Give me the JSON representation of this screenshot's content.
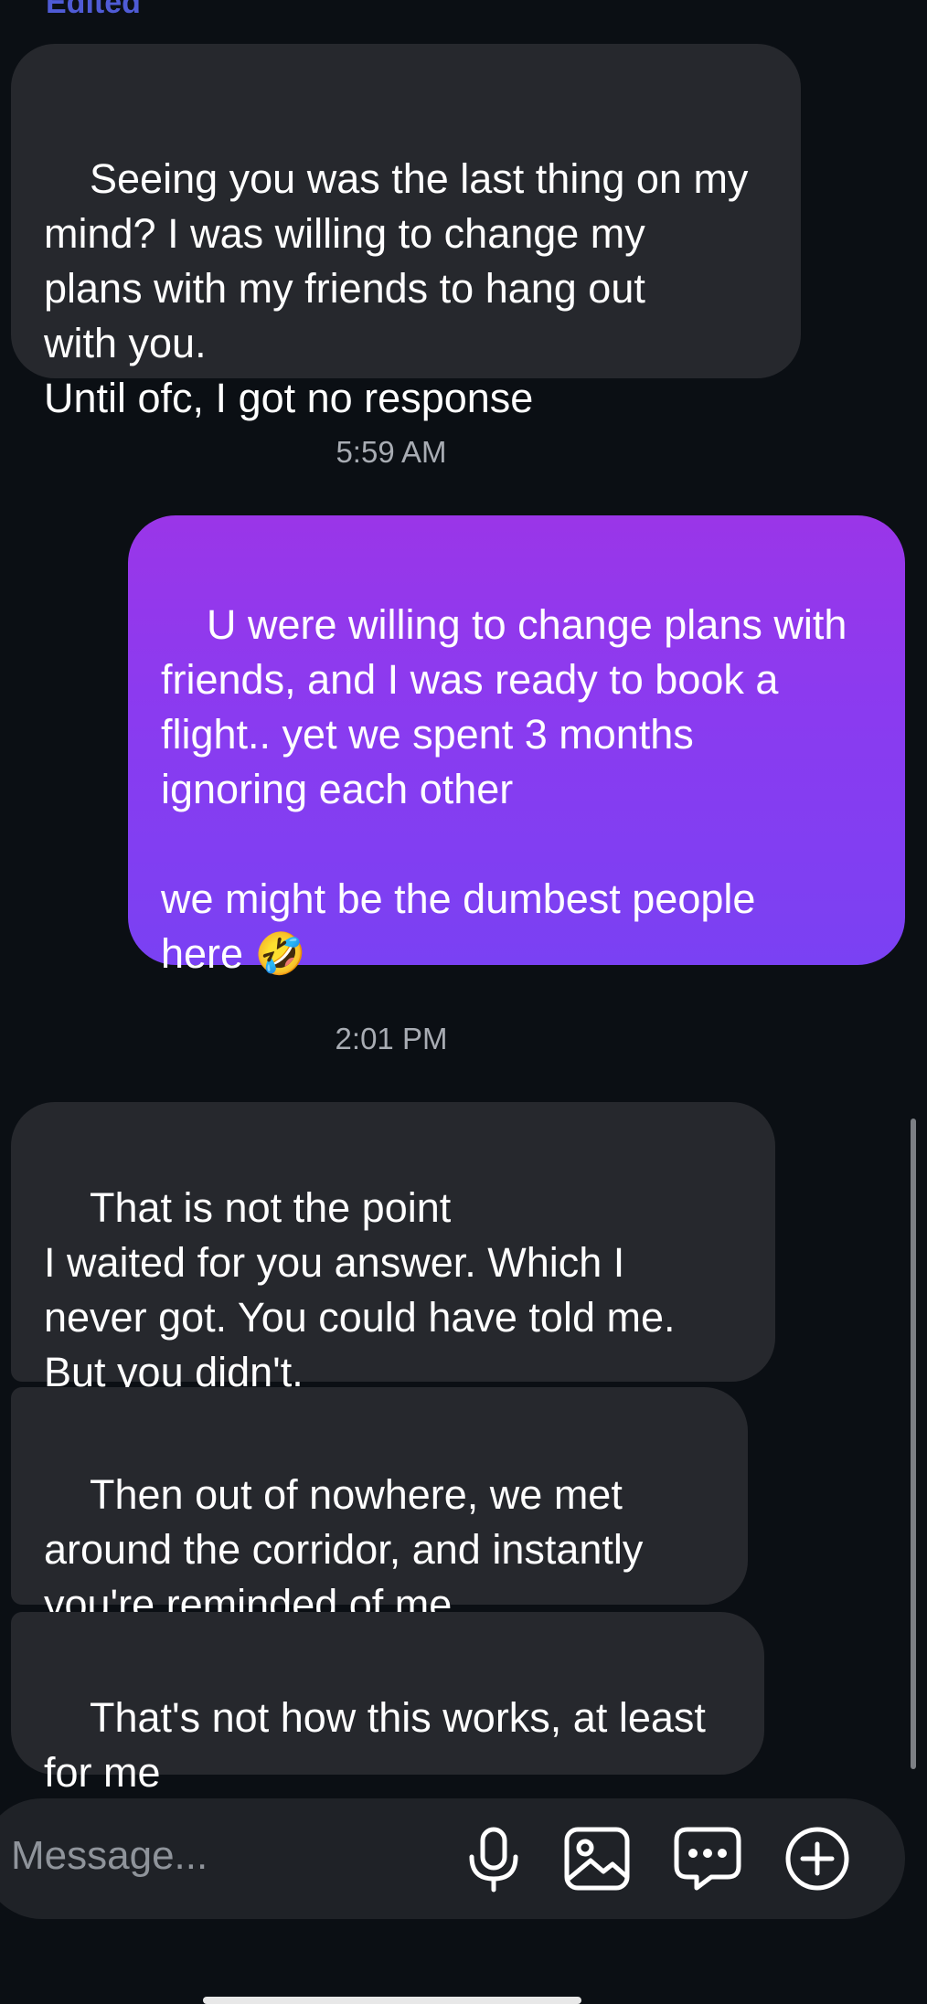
{
  "thread": {
    "edited_label": "Edited",
    "messages": [
      {
        "side": "received",
        "text": "Seeing you was the last thing on my\nmind? I was willing to change my\nplans with my friends to hang out\nwith you.\nUntil ofc, I got no response"
      },
      {
        "timestamp": "5:59 AM"
      },
      {
        "side": "sent",
        "text": "U were willing to change plans with\nfriends, and I was ready to book a\nflight.. yet we spent 3 months\nignoring each other\n\nwe might be the dumbest people\nhere 🤣"
      },
      {
        "timestamp": "2:01 PM"
      },
      {
        "side": "received",
        "text": "That is not the point\nI waited for you answer. Which I\nnever got. You could have told me.\nBut you didn't."
      },
      {
        "side": "received",
        "text": "Then out of nowhere, we met\naround the corridor, and instantly\nyou're reminded of me"
      },
      {
        "side": "received",
        "text": "That's not how this works, at least\nfor me"
      }
    ]
  },
  "composer": {
    "placeholder": "Message...",
    "icons": [
      "microphone-icon",
      "image-icon",
      "sticker-chat-icon",
      "plus-icon"
    ]
  },
  "colors": {
    "background": "#0b0f14",
    "received_bubble": "#26282d",
    "sent_bubble_top": "#9a36e8",
    "sent_bubble_bottom": "#7a41f3",
    "edited_label": "#4f5bd5"
  }
}
